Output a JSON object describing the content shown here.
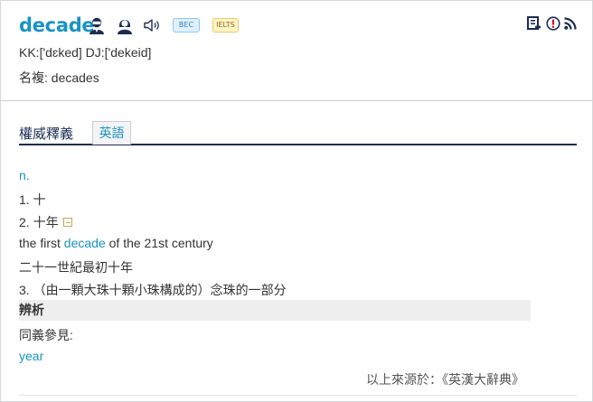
{
  "entry": {
    "word": "decade",
    "badges": {
      "bec": "BEC",
      "ielts": "IELTS"
    },
    "pronunciation": "KK:['dɛked] DJ:['dekeid]",
    "plural": "名複: decades"
  },
  "tabs": {
    "main_label": "權威釋義",
    "english_label": "英語"
  },
  "definitions": {
    "pos": "n.",
    "sense1": "1. 十",
    "sense2": "2. 十年",
    "example_before": "the first ",
    "example_keyword": "decade",
    "example_after": " of the 21st century",
    "example_translation": "二十一世紀最初十年",
    "sense3": "3. （由一顆大珠十顆小珠構成的）念珠的一部分"
  },
  "analysis": {
    "heading": "辨析",
    "synonym_label": "同義參見:",
    "synonym_link": "year"
  },
  "source": "以上來源於：《英漢大辭典》",
  "colors": {
    "accent": "#1a92c4",
    "navy": "#1b2c52"
  }
}
